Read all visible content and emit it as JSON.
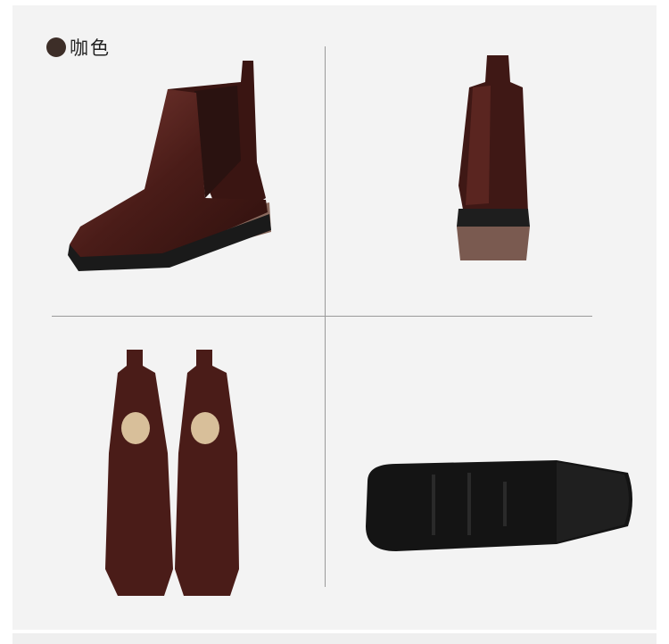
{
  "color_option": {
    "label": "咖色",
    "swatch_color": "#3d2e28"
  },
  "views": [
    {
      "name": "side",
      "icon": "boot-side-view"
    },
    {
      "name": "back",
      "icon": "boot-back-view"
    },
    {
      "name": "top",
      "icon": "boot-pair-top-view"
    },
    {
      "name": "sole",
      "icon": "boot-sole-view"
    }
  ],
  "colors": {
    "leather": "#4a1c18",
    "leather_highlight": "#7a3a33",
    "heel": "#8a6a5e",
    "sole": "#1a1a1a",
    "background": "#f3f3f3"
  }
}
